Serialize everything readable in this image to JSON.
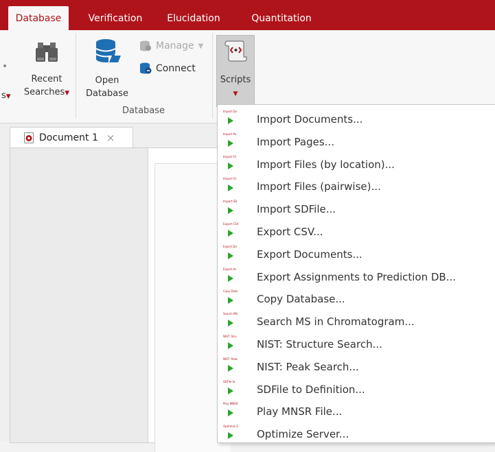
{
  "ribbon": {
    "tabs": [
      {
        "label": "Database"
      },
      {
        "label": "Verification"
      },
      {
        "label": "Elucidation"
      },
      {
        "label": "Quantitation"
      }
    ],
    "partial_label": "s",
    "recent_searches": {
      "line1": "Recent",
      "line2": "Searches"
    },
    "open_database": {
      "line1": "Open",
      "line2": "Database"
    },
    "manage_label": "Manage",
    "connect_label": "Connect",
    "database_group_label": "Database",
    "scripts_label": "Scripts"
  },
  "document": {
    "tab_label": "Document 1",
    "close_glyph": "×"
  },
  "scripts_menu": {
    "items": [
      {
        "label": "Import Documents...",
        "icon_caption": "Import Do"
      },
      {
        "label": "Import Pages...",
        "icon_caption": "Import Pa"
      },
      {
        "label": "Import Files (by location)...",
        "icon_caption": "Import Fil"
      },
      {
        "label": "Import Files (pairwise)...",
        "icon_caption": "Import Fil"
      },
      {
        "label": "Import SDFile...",
        "icon_caption": "Import SD"
      },
      {
        "label": "Export CSV...",
        "icon_caption": "Export CSV"
      },
      {
        "label": "Export Documents...",
        "icon_caption": "Export Do"
      },
      {
        "label": "Export Assignments to Prediction DB...",
        "icon_caption": "Export As"
      },
      {
        "label": "Copy Database...",
        "icon_caption": "Copy Data"
      },
      {
        "label": "Search MS in Chromatogram...",
        "icon_caption": "Search MS"
      },
      {
        "label": "NIST: Structure Search...",
        "icon_caption": "NIST: Stru"
      },
      {
        "label": "NIST: Peak Search...",
        "icon_caption": "NIST: Peak"
      },
      {
        "label": "SDFile to Definition...",
        "icon_caption": "SDFile to"
      },
      {
        "label": "Play MNSR File...",
        "icon_caption": "Play MNSR"
      },
      {
        "label": "Optimize Server...",
        "icon_caption": "Optimize S"
      }
    ]
  },
  "colors": {
    "brand_red": "#b0141b",
    "play_green": "#2aa52a"
  }
}
